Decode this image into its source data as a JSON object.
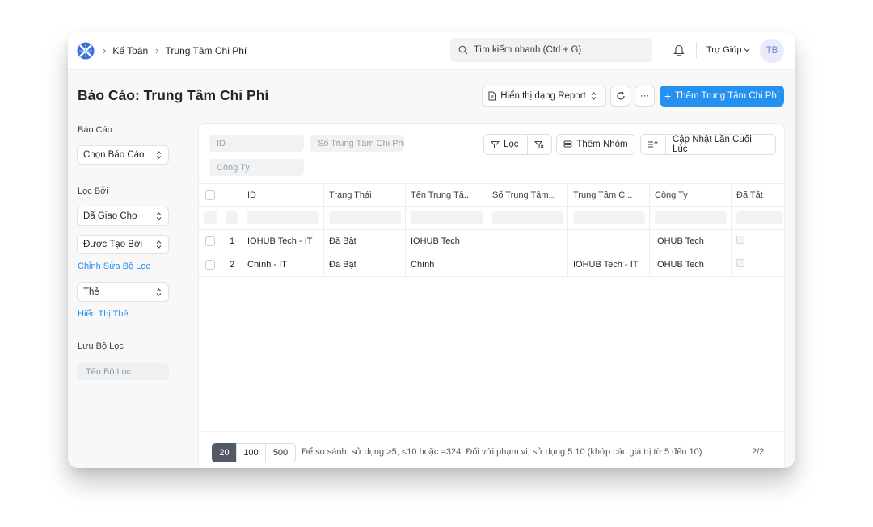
{
  "breadcrumb": {
    "items": [
      "Kế Toán",
      "Trung Tâm Chi Phí"
    ]
  },
  "search": {
    "placeholder": "Tìm kiếm nhanh (Ctrl + G)"
  },
  "header": {
    "help_label": "Trợ Giúp",
    "avatar_initials": "TB"
  },
  "page": {
    "title": "Báo Cáo: Trung Tâm Chi Phí",
    "view_label": "Hiển thị dạng Report",
    "more_label": "···",
    "primary_label": "Thêm Trung Tâm Chi Phí"
  },
  "sidebar": {
    "report_heading": "Báo Cáo",
    "report_select": "Chọn Báo Cáo",
    "filter_heading": "Lọc Bởi",
    "assigned_to": "Đã Giao Cho",
    "created_by": "Được Tạo Bởi",
    "edit_filters": "Chỉnh Sửa Bộ Lọc",
    "tags": "Thẻ",
    "show_tags": "Hiển Thị Thẻ",
    "save_filter_heading": "Lưu Bộ Lọc",
    "filter_name_placeholder": "Tên Bộ Lọc"
  },
  "filters": {
    "id_placeholder": "ID",
    "number_placeholder": "Số Trung Tâm Chi Phí",
    "company_placeholder": "Công Ty",
    "filter_label": "Lọc",
    "group_label": "Thêm Nhóm",
    "sort_label": "Cập Nhật Lần Cuối Lúc"
  },
  "table": {
    "columns": [
      "ID",
      "Trạng Thái",
      "Tên Trung Tâ...",
      "Số Trung Tâm...",
      "Trung Tâm C...",
      "Công Ty",
      "Đã Tắt"
    ],
    "rows": [
      {
        "index": "1",
        "id": "IOHUB Tech - IT",
        "status": "Đã Bật",
        "name": "IOHUB Tech",
        "number": "",
        "parent": "",
        "company": "IOHUB Tech"
      },
      {
        "index": "2",
        "id": "Chính - IT",
        "status": "Đã Bật",
        "name": "Chính",
        "number": "",
        "parent": "IOHUB Tech - IT",
        "company": "IOHUB Tech"
      }
    ]
  },
  "pagination": {
    "sizes": [
      "20",
      "100",
      "500"
    ],
    "hint": "Để so sánh, sử dụng >5, <10 hoặc =324. Đối với phạm vi, sử dụng 5:10 (khớp các giá trị từ 5 đến 10).",
    "count": "2/2"
  },
  "colors": {
    "primary": "#2490ef",
    "active_page": "#525a63",
    "avatar_bg": "#e8ebfa"
  }
}
